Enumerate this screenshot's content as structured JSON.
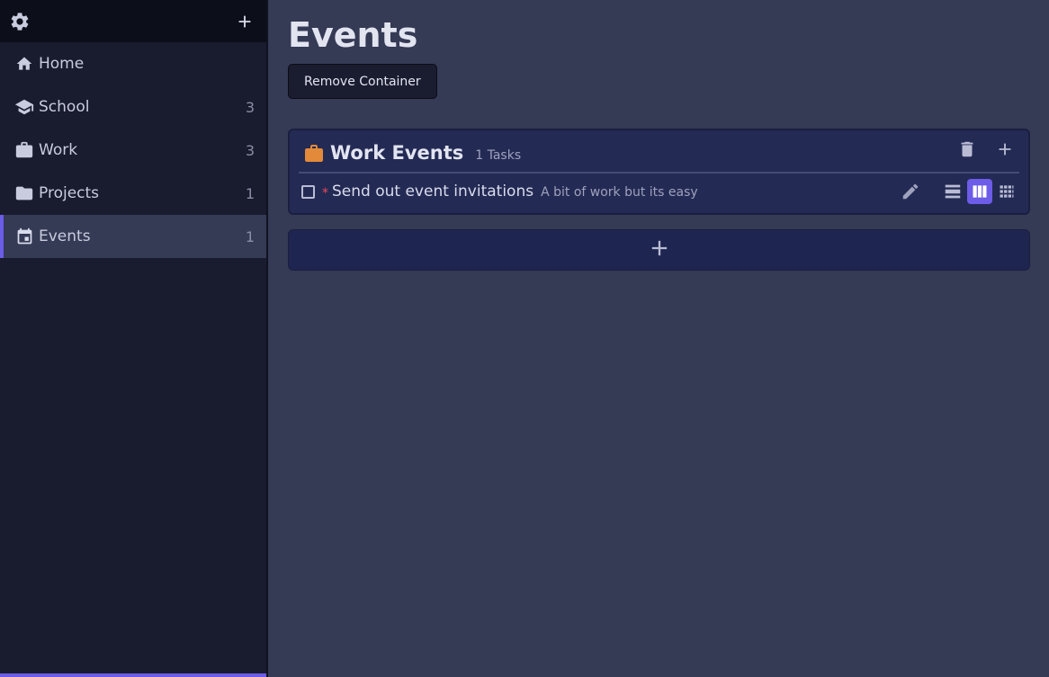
{
  "sidebar": {
    "top": {
      "settings_icon": "gear-icon",
      "add_icon": "plus-icon"
    },
    "items": [
      {
        "label": "Home",
        "icon": "home-icon",
        "count": ""
      },
      {
        "label": "School",
        "icon": "graduation-cap-icon",
        "count": "3"
      },
      {
        "label": "Work",
        "icon": "briefcase-icon",
        "count": "3"
      },
      {
        "label": "Projects",
        "icon": "folder-icon",
        "count": "1"
      },
      {
        "label": "Events",
        "icon": "calendar-icon",
        "count": "1",
        "active": true
      }
    ]
  },
  "main": {
    "title": "Events",
    "remove_button_label": "Remove Container",
    "container": {
      "title": "Work Events",
      "count_label": "1 Tasks",
      "icon": "briefcase-icon",
      "icon_color": "#e28a3a",
      "actions": [
        "trash-icon",
        "plus-icon"
      ],
      "tasks": [
        {
          "title": "Send out event invitations",
          "description": "A bit of work but its easy",
          "priority_marker": "*",
          "checked": false
        }
      ],
      "view_modes": [
        "list-view-icon",
        "columns-view-icon",
        "grid-view-icon"
      ],
      "active_view": "columns-view-icon"
    },
    "add_container_icon": "plus-icon"
  },
  "colors": {
    "accent": "#6c5ce7",
    "sidebar_bg": "#191b2e",
    "main_bg": "#353a55",
    "card_bg": "#232a54",
    "priority": "#e74c5c"
  }
}
